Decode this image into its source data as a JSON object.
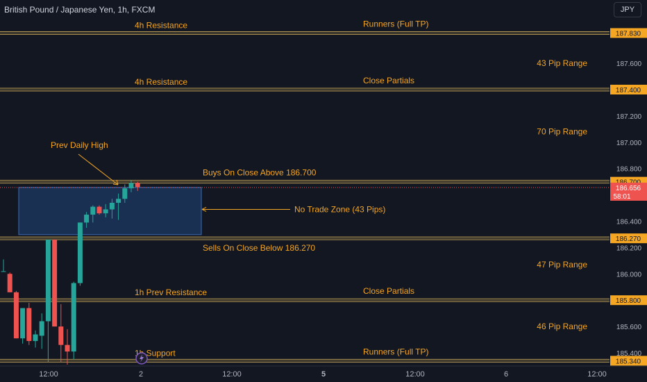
{
  "header": {
    "symbol_title": "British Pound / Japanese Yen, 1h, FXCM",
    "currency_button": "JPY"
  },
  "colors": {
    "background": "#131722",
    "up": "#26a69a",
    "down": "#ef5350",
    "annotation": "#f5a623",
    "level_line": "#b99b54",
    "zone_fill": "#1e3a63",
    "zone_border": "#3b6cb5"
  },
  "chart_data": {
    "type": "candlestick",
    "symbol": "GBPJPY",
    "timeframe": "1h",
    "y_axis": {
      "range": [
        185.3,
        187.93
      ],
      "tick_labels": [
        "187.600",
        "187.200",
        "187.000",
        "186.800",
        "186.400",
        "186.200",
        "186.000",
        "185.600",
        "185.400"
      ]
    },
    "x_axis": {
      "tick_labels": [
        {
          "label": "12:00",
          "bold": false
        },
        {
          "label": "2",
          "bold": false
        },
        {
          "label": "12:00",
          "bold": false
        },
        {
          "label": "5",
          "bold": true
        },
        {
          "label": "12:00",
          "bold": false
        },
        {
          "label": "6",
          "bold": false
        },
        {
          "label": "12:00",
          "bold": false
        }
      ]
    },
    "levels": [
      {
        "price": 187.83,
        "badge": "187.830",
        "left_label": "4h Resistance",
        "right_label": "Runners (Full TP)"
      },
      {
        "price": 187.4,
        "badge": "187.400",
        "left_label": "4h Resistance",
        "right_label": "Close Partials"
      },
      {
        "price": 186.7,
        "badge": "186.700",
        "left_label": "",
        "right_label": ""
      },
      {
        "price": 186.27,
        "badge": "186.270",
        "left_label": "",
        "right_label": ""
      },
      {
        "price": 185.8,
        "badge": "185.800",
        "left_label": "1h Prev Resistance",
        "right_label": "Close Partials"
      },
      {
        "price": 185.34,
        "badge": "185.340",
        "left_label": "1h Support",
        "right_label": "Runners (Full TP)"
      }
    ],
    "current_price": {
      "value": 186.656,
      "label": "186.656",
      "countdown": "58:01"
    },
    "annotations": {
      "buys_text": "Buys On Close Above 186.700",
      "sells_text": "Sells On Close Below 186.270",
      "no_trade_zone": "No Trade Zone (43 Pips)",
      "prev_daily_high": "Prev Daily High"
    },
    "ranges": [
      {
        "text": "43 Pip Range",
        "price": 187.6
      },
      {
        "text": "70 Pip Range",
        "price": 187.08
      },
      {
        "text": "47 Pip Range",
        "price": 186.07
      },
      {
        "text": "46 Pip Range",
        "price": 185.6
      }
    ],
    "no_trade_zone": {
      "price_top": 186.657,
      "price_bottom": 186.298
    },
    "candles": [
      {
        "o": 186.02,
        "h": 186.11,
        "l": 186.02,
        "c": 186.02
      },
      {
        "o": 186.0,
        "h": 186.01,
        "l": 185.86,
        "c": 185.86
      },
      {
        "o": 185.86,
        "h": 185.87,
        "l": 185.51,
        "c": 185.51
      },
      {
        "o": 185.51,
        "h": 185.74,
        "l": 185.47,
        "c": 185.74
      },
      {
        "o": 185.74,
        "h": 185.78,
        "l": 185.46,
        "c": 185.49
      },
      {
        "o": 185.49,
        "h": 185.57,
        "l": 185.44,
        "c": 185.54
      },
      {
        "o": 185.53,
        "h": 185.7,
        "l": 185.43,
        "c": 185.64
      },
      {
        "o": 185.64,
        "h": 186.26,
        "l": 185.33,
        "c": 186.26
      },
      {
        "o": 186.26,
        "h": 186.26,
        "l": 185.6,
        "c": 185.6
      },
      {
        "o": 185.6,
        "h": 185.77,
        "l": 185.33,
        "c": 185.46
      },
      {
        "o": 185.46,
        "h": 185.58,
        "l": 185.31,
        "c": 185.41
      },
      {
        "o": 185.41,
        "h": 185.94,
        "l": 185.35,
        "c": 185.93
      },
      {
        "o": 185.93,
        "h": 186.39,
        "l": 185.91,
        "c": 186.39
      },
      {
        "o": 186.39,
        "h": 186.47,
        "l": 186.35,
        "c": 186.45
      },
      {
        "o": 186.45,
        "h": 186.52,
        "l": 186.39,
        "c": 186.51
      },
      {
        "o": 186.51,
        "h": 186.52,
        "l": 186.45,
        "c": 186.46
      },
      {
        "o": 186.46,
        "h": 186.53,
        "l": 186.43,
        "c": 186.49
      },
      {
        "o": 186.49,
        "h": 186.57,
        "l": 186.42,
        "c": 186.54
      },
      {
        "o": 186.54,
        "h": 186.61,
        "l": 186.41,
        "c": 186.57
      },
      {
        "o": 186.57,
        "h": 186.68,
        "l": 186.54,
        "c": 186.65
      },
      {
        "o": 186.65,
        "h": 186.71,
        "l": 186.62,
        "c": 186.69
      },
      {
        "o": 186.69,
        "h": 186.7,
        "l": 186.63,
        "c": 186.66
      }
    ]
  }
}
